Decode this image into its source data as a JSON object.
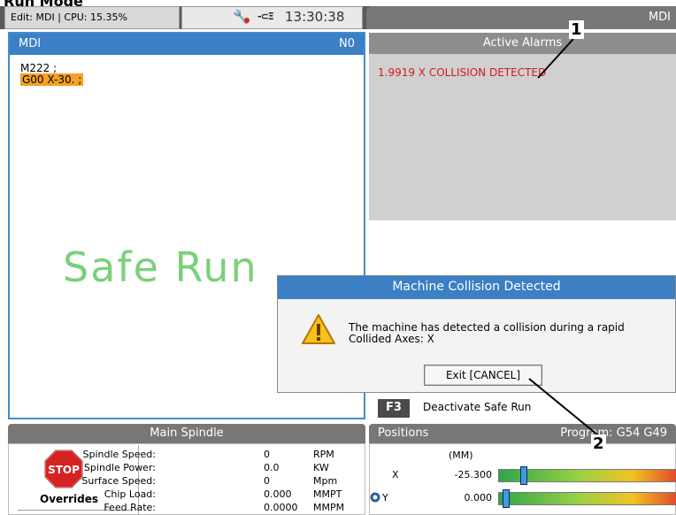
{
  "top_heading": "Run Mode",
  "status_bar": {
    "left_text": "Edit: MDI | CPU: 15.35%",
    "clock": "13:30:38",
    "mode": "MDI"
  },
  "mdi": {
    "title": "MDI",
    "line_label": "N0",
    "code": [
      "M222 ;",
      "G00 X-30. ;"
    ],
    "watermark": "Safe Run"
  },
  "alarms": {
    "title": "Active Alarms",
    "items": [
      "1.9919  X COLLISION DETECTED"
    ]
  },
  "dialog": {
    "title": "Machine Collision Detected",
    "message_line1": "The machine has detected a collision during a rapid",
    "message_line2": "Collided Axes: X",
    "exit_label": "Exit [CANCEL]"
  },
  "f3": {
    "key": "F3",
    "label": "Deactivate Safe Run"
  },
  "spindle": {
    "title": "Main Spindle",
    "stop_label": "STOP",
    "overrides_label": "Overrides",
    "rows": [
      {
        "label": "Spindle Speed:",
        "value": "0",
        "unit": "RPM"
      },
      {
        "label": "Spindle Power:",
        "value": "0.0",
        "unit": "KW"
      },
      {
        "label": "Surface Speed:",
        "value": "0",
        "unit": "Mpm"
      },
      {
        "label": "Chip Load:",
        "value": "0.000",
        "unit": "MMPT"
      },
      {
        "label": "Feed Rate:",
        "value": "0.0000",
        "unit": "MMPM"
      }
    ]
  },
  "positions": {
    "title": "Positions",
    "program_label": "Program: G54 G49",
    "units": "(MM)",
    "axes": [
      {
        "name": "X",
        "value": "-25.300",
        "bar_level": 0.12
      },
      {
        "name": "Y",
        "value": "0.000",
        "bar_level": 0.02
      }
    ]
  },
  "callouts": [
    "1",
    "2"
  ],
  "colors": {
    "accent_blue": "#3b7fc4",
    "alarm_red": "#d01c1c",
    "highlight_orange": "#f4a024",
    "safe_run_green": "#7bd07b"
  }
}
